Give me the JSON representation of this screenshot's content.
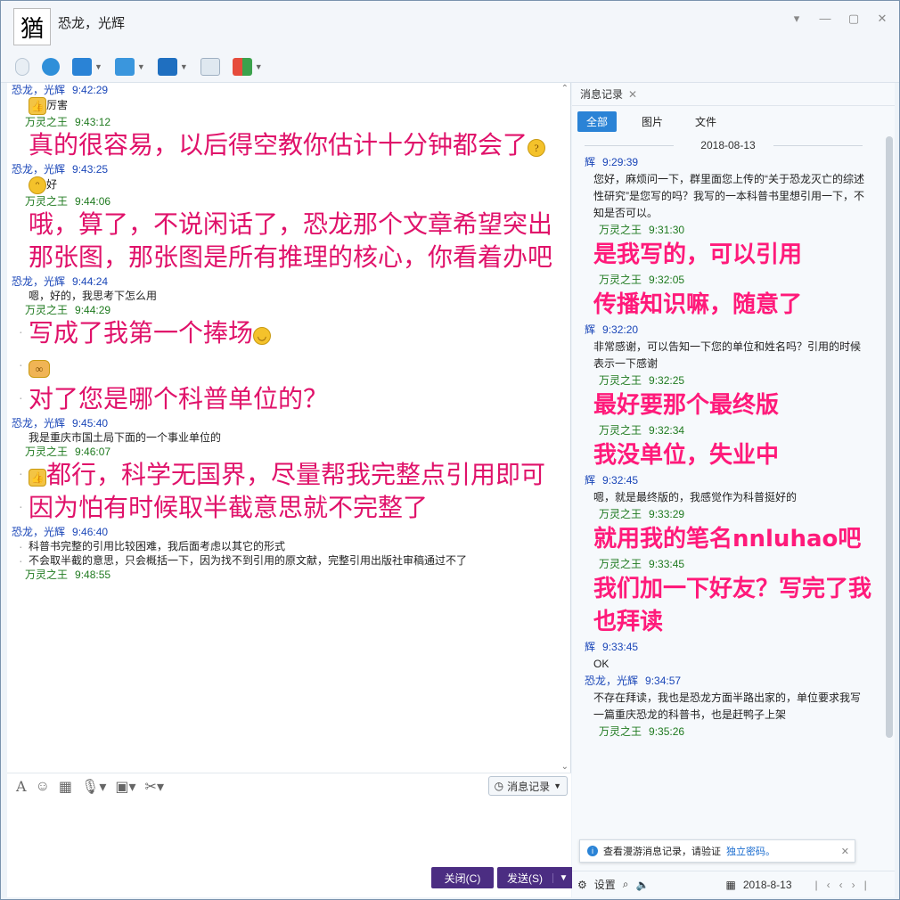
{
  "window": {
    "title": "恐龙，光辉",
    "avatar_glyph": "猶"
  },
  "toolbar": {
    "buttons": [
      "microphone-icon",
      "camera-icon",
      "screen-share-icon",
      "file-transfer-icon",
      "remote-desktop-icon",
      "add-app-icon",
      "apps-grid-icon"
    ]
  },
  "chat": {
    "messages": [
      {
        "from": "me",
        "name": "恐龙，光辉",
        "time": "9:42:29",
        "lines": [
          {
            "size": "small",
            "emoji": "thumb",
            "text": "厉害"
          }
        ]
      },
      {
        "from": "other",
        "name": "万灵之王",
        "time": "9:43:12",
        "lines": [
          {
            "size": "big",
            "text": "真的很容易，以后得空教你估计十分钟都会了",
            "emoji_after": "think"
          }
        ]
      },
      {
        "from": "me",
        "name": "恐龙，光辉",
        "time": "9:43:25",
        "lines": [
          {
            "size": "small",
            "emoji": "grin",
            "text": "好"
          }
        ]
      },
      {
        "from": "other",
        "name": "万灵之王",
        "time": "9:44:06",
        "lines": [
          {
            "size": "big",
            "text": "哦，算了，不说闲话了，恐龙那个文章希望突出那张图，那张图是所有推理的核心，你看着办吧"
          }
        ]
      },
      {
        "from": "me",
        "name": "恐龙，光辉",
        "time": "9:44:24",
        "lines": [
          {
            "size": "small",
            "text": "嗯，好的，我思考下怎么用"
          }
        ]
      },
      {
        "from": "other",
        "name": "万灵之王",
        "time": "9:44:29",
        "lines": [
          {
            "size": "big",
            "bullet": true,
            "text": "写成了我第一个捧场",
            "emoji_after": "smile"
          },
          {
            "size": "big",
            "bullet": true,
            "emoji": "shake",
            "text": ""
          },
          {
            "size": "big",
            "bullet": true,
            "text": "对了您是哪个科普单位的？"
          }
        ]
      },
      {
        "from": "me",
        "name": "恐龙，光辉",
        "time": "9:45:40",
        "lines": [
          {
            "size": "small",
            "text": "我是重庆市国土局下面的一个事业单位的"
          }
        ]
      },
      {
        "from": "other",
        "name": "万灵之王",
        "time": "9:46:07",
        "lines": [
          {
            "size": "big",
            "bullet": true,
            "emoji": "thumb",
            "text": "都行，科学无国界，尽量帮我完整点引用即可"
          },
          {
            "size": "big",
            "bullet": true,
            "text": "因为怕有时候取半截意思就不完整了"
          }
        ]
      },
      {
        "from": "me",
        "name": "恐龙，光辉",
        "time": "9:46:40",
        "lines": [
          {
            "size": "small",
            "bullet": true,
            "text": "科普书完整的引用比较困难，我后面考虑以其它的形式"
          },
          {
            "size": "small",
            "bullet": true,
            "text": "不会取半截的意思，只会概括一下，因为找不到引用的原文献，完整引用出版社审稿通过不了"
          }
        ]
      },
      {
        "from": "other",
        "name": "万灵之王",
        "time": "9:48:55",
        "lines": []
      }
    ]
  },
  "input": {
    "toolbar_icons": [
      "font-icon",
      "emoji-icon",
      "gif-icon",
      "voice-icon",
      "image-icon",
      "scissors-icon"
    ],
    "msg_record_label": "消息记录",
    "close_label": "关闭(C)",
    "send_label": "发送(S)"
  },
  "history": {
    "tab_title": "消息记录",
    "filters": [
      "全部",
      "图片",
      "文件"
    ],
    "date": "2018-08-13",
    "entries": [
      {
        "from": "me",
        "name": "辉",
        "time": "9:29:39",
        "size": "small",
        "text": "您好，麻烦问一下，群里面您上传的“关于恐龙灭亡的综述性研究”是您写的吗？我写的一本科普书里想引用一下，不知是否可以。"
      },
      {
        "from": "other",
        "name": "万灵之王",
        "time": "9:31:30",
        "size": "big",
        "text": "是我写的，可以引用"
      },
      {
        "from": "other",
        "name": "万灵之王",
        "time": "9:32:05",
        "size": "big",
        "text": "传播知识嘛，随意了"
      },
      {
        "from": "me",
        "name": "辉",
        "time": "9:32:20",
        "size": "small",
        "text": "非常感谢，可以告知一下您的单位和姓名吗？引用的时候表示一下感谢"
      },
      {
        "from": "other",
        "name": "万灵之王",
        "time": "9:32:25",
        "size": "big",
        "text": "最好要那个最终版"
      },
      {
        "from": "other",
        "name": "万灵之王",
        "time": "9:32:34",
        "size": "big",
        "text": "我没单位，失业中"
      },
      {
        "from": "me",
        "name": "辉",
        "time": "9:32:45",
        "size": "small",
        "text": "嗯，就是最终版的，我感觉作为科普挺好的"
      },
      {
        "from": "other",
        "name": "万灵之王",
        "time": "9:33:29",
        "size": "big",
        "text": "就用我的笔名nnluhao吧"
      },
      {
        "from": "other",
        "name": "万灵之王",
        "time": "9:33:45",
        "size": "big",
        "text": "我们加一下好友？写完了我也拜读"
      },
      {
        "from": "me",
        "name": "辉",
        "time": "9:33:45",
        "size": "small",
        "text": "OK"
      },
      {
        "from": "me",
        "name": "恐龙，光辉",
        "time": "9:34:57",
        "size": "small",
        "text": "不存在拜读，我也是恐龙方面半路出家的，单位要求我写一篇重庆恐龙的科普书，也是赶鸭子上架"
      },
      {
        "from": "other",
        "name": "万灵之王",
        "time": "9:35:26",
        "size": "small",
        "text": ""
      }
    ],
    "notice_text": "查看漫游消息记录，请验证",
    "notice_link": "独立密码。",
    "footer_settings": "设置",
    "footer_date": "2018-8-13"
  },
  "colors": {
    "accent": "#2a83d6",
    "big_text": "#e0126a",
    "button": "#4b2d82"
  }
}
